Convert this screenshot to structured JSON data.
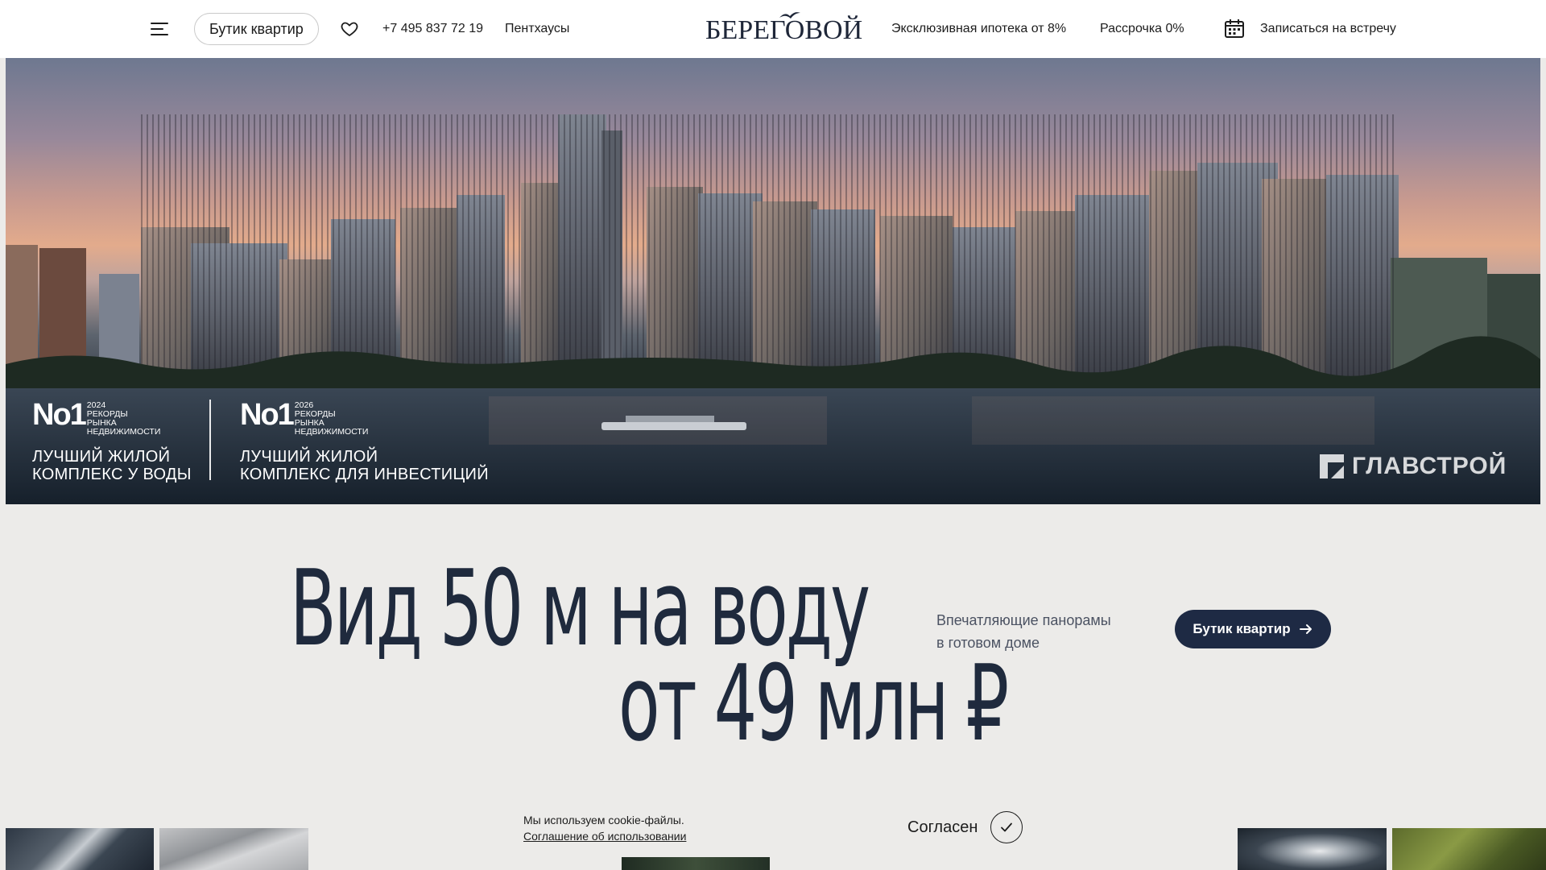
{
  "header": {
    "boutique_button": "Бутик квартир",
    "phone": "+7 495 837 72 19",
    "penthouses": "Пентхаусы",
    "logo_text": "БЕРЕГОВОЙ",
    "mortgage": "Эксклюзивная ипотека от 8%",
    "installment": "Рассрочка 0%",
    "appointment": "Записаться на встречу"
  },
  "hero": {
    "awards": [
      {
        "number": "No1",
        "year": "2024",
        "meta_1": "Рекорды",
        "meta_2": "рынка",
        "meta_3": "недвижимости",
        "title_1": "Лучший жилой",
        "title_2": "комплекс у воды"
      },
      {
        "number": "No1",
        "year": "2026",
        "meta_1": "Рекорды",
        "meta_2": "рынка",
        "meta_3": "недвижимости",
        "title_1": "Лучший жилой",
        "title_2": "комплекс для инвестиций"
      }
    ],
    "brand": "ГЛАВСТРОЙ"
  },
  "promo": {
    "headline_1": "Вид 50 м на воду",
    "headline_2": "от 49 млн ₽",
    "sub_1": "Впечатляющие панорамы",
    "sub_2": "в готовом доме",
    "cta": "Бутик квартир"
  },
  "cookie": {
    "text": "Мы используем cookie-файлы.",
    "link": "Соглашение об использовании",
    "agree": "Согласен"
  },
  "colors": {
    "accent": "#1e2a44",
    "background": "#ecebe9",
    "header_bg": "#ffffff"
  }
}
